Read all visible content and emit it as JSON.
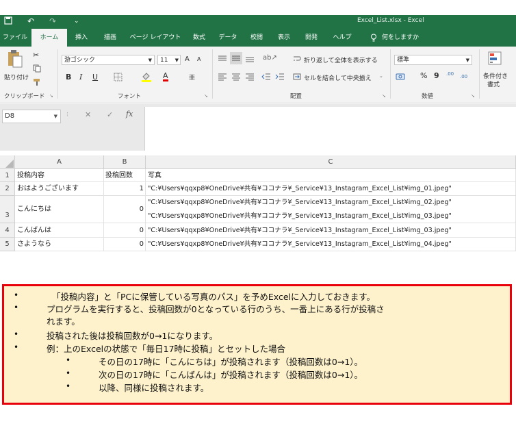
{
  "window": {
    "title": "Excel_List.xlsx  -  Excel",
    "quick_access": {
      "save_icon": "save-icon",
      "undo": "↶",
      "redo": "↷",
      "customize": "⌄"
    }
  },
  "tabs": [
    "ファイル",
    "ホーム",
    "挿入",
    "描画",
    "ページ レイアウト",
    "数式",
    "データ",
    "校閲",
    "表示",
    "開発",
    "ヘルプ",
    "何をしますか"
  ],
  "ribbon": {
    "clipboard": {
      "paste": "貼り付け",
      "label": "クリップボード"
    },
    "font": {
      "family": "游ゴシック",
      "size": "11",
      "grow": "A",
      "shrink": "A",
      "bold": "B",
      "italic": "I",
      "underline": "U",
      "label": "フォント"
    },
    "alignment": {
      "wrap": "折り返して全体を表示する",
      "merge": "セルを結合して中央揃え",
      "label": "配置"
    },
    "number": {
      "format": "標準",
      "percent": "%",
      "comma": "9",
      "inc": ".00",
      "dec": ".00",
      "label": "数値"
    },
    "styles": {
      "cond1": "条件付き",
      "cond2": "書式"
    }
  },
  "formula_bar": {
    "name_box": "D8",
    "cancel": "✕",
    "enter": "✓",
    "fx": "fx",
    "value": ""
  },
  "sheet": {
    "columns": [
      "A",
      "B",
      "C"
    ],
    "rows": [
      {
        "num": "1",
        "a": "投稿内容",
        "b": "投稿回数",
        "c": "写真",
        "c2": ""
      },
      {
        "num": "2",
        "a": "おはようございます",
        "b": "1",
        "c": "\"C:¥Users¥qqxp8¥OneDrive¥共有¥ココナラ¥_Service¥13_Instagram_Excel_List¥img_01.jpeg\"",
        "c2": ""
      },
      {
        "num": "3",
        "a": "こんにちは",
        "b": "0",
        "c": "\"C:¥Users¥qqxp8¥OneDrive¥共有¥ココナラ¥_Service¥13_Instagram_Excel_List¥img_02.jpeg\"",
        "c2": "\"C:¥Users¥qqxp8¥OneDrive¥共有¥ココナラ¥_Service¥13_Instagram_Excel_List¥img_03.jpeg\""
      },
      {
        "num": "4",
        "a": "こんばんは",
        "b": "0",
        "c": "\"C:¥Users¥qqxp8¥OneDrive¥共有¥ココナラ¥_Service¥13_Instagram_Excel_List¥img_03.jpeg\"",
        "c2": ""
      },
      {
        "num": "5",
        "a": "さようなら",
        "b": "0",
        "c": "\"C:¥Users¥qqxp8¥OneDrive¥共有¥ココナラ¥_Service¥13_Instagram_Excel_List¥img_04.jpeg\"",
        "c2": ""
      }
    ]
  },
  "notes": {
    "bullet": "•",
    "lines": [
      "「投稿内容」と「PCに保管している写真のパス」を予めExcelに入力しておきます。",
      "プログラムを実行すると、投稿回数が0となっている行のうち、一番上にある行が投稿さ",
      "れます。",
      "投稿された後は投稿回数が0→1になります。",
      "例：上のExcelの状態で「毎日17時に投稿」とセットした場合",
      "その日の17時に「こんにちは」が投稿されます（投稿回数は0→1）。",
      "次の日の17時に「こんばんは」が投稿されます（投稿回数は0→1）。",
      "以降、同様に投稿されます。"
    ]
  },
  "colors": {
    "excel_green": "#217346",
    "note_bg": "#fef2cc",
    "note_border": "#e8000b"
  }
}
